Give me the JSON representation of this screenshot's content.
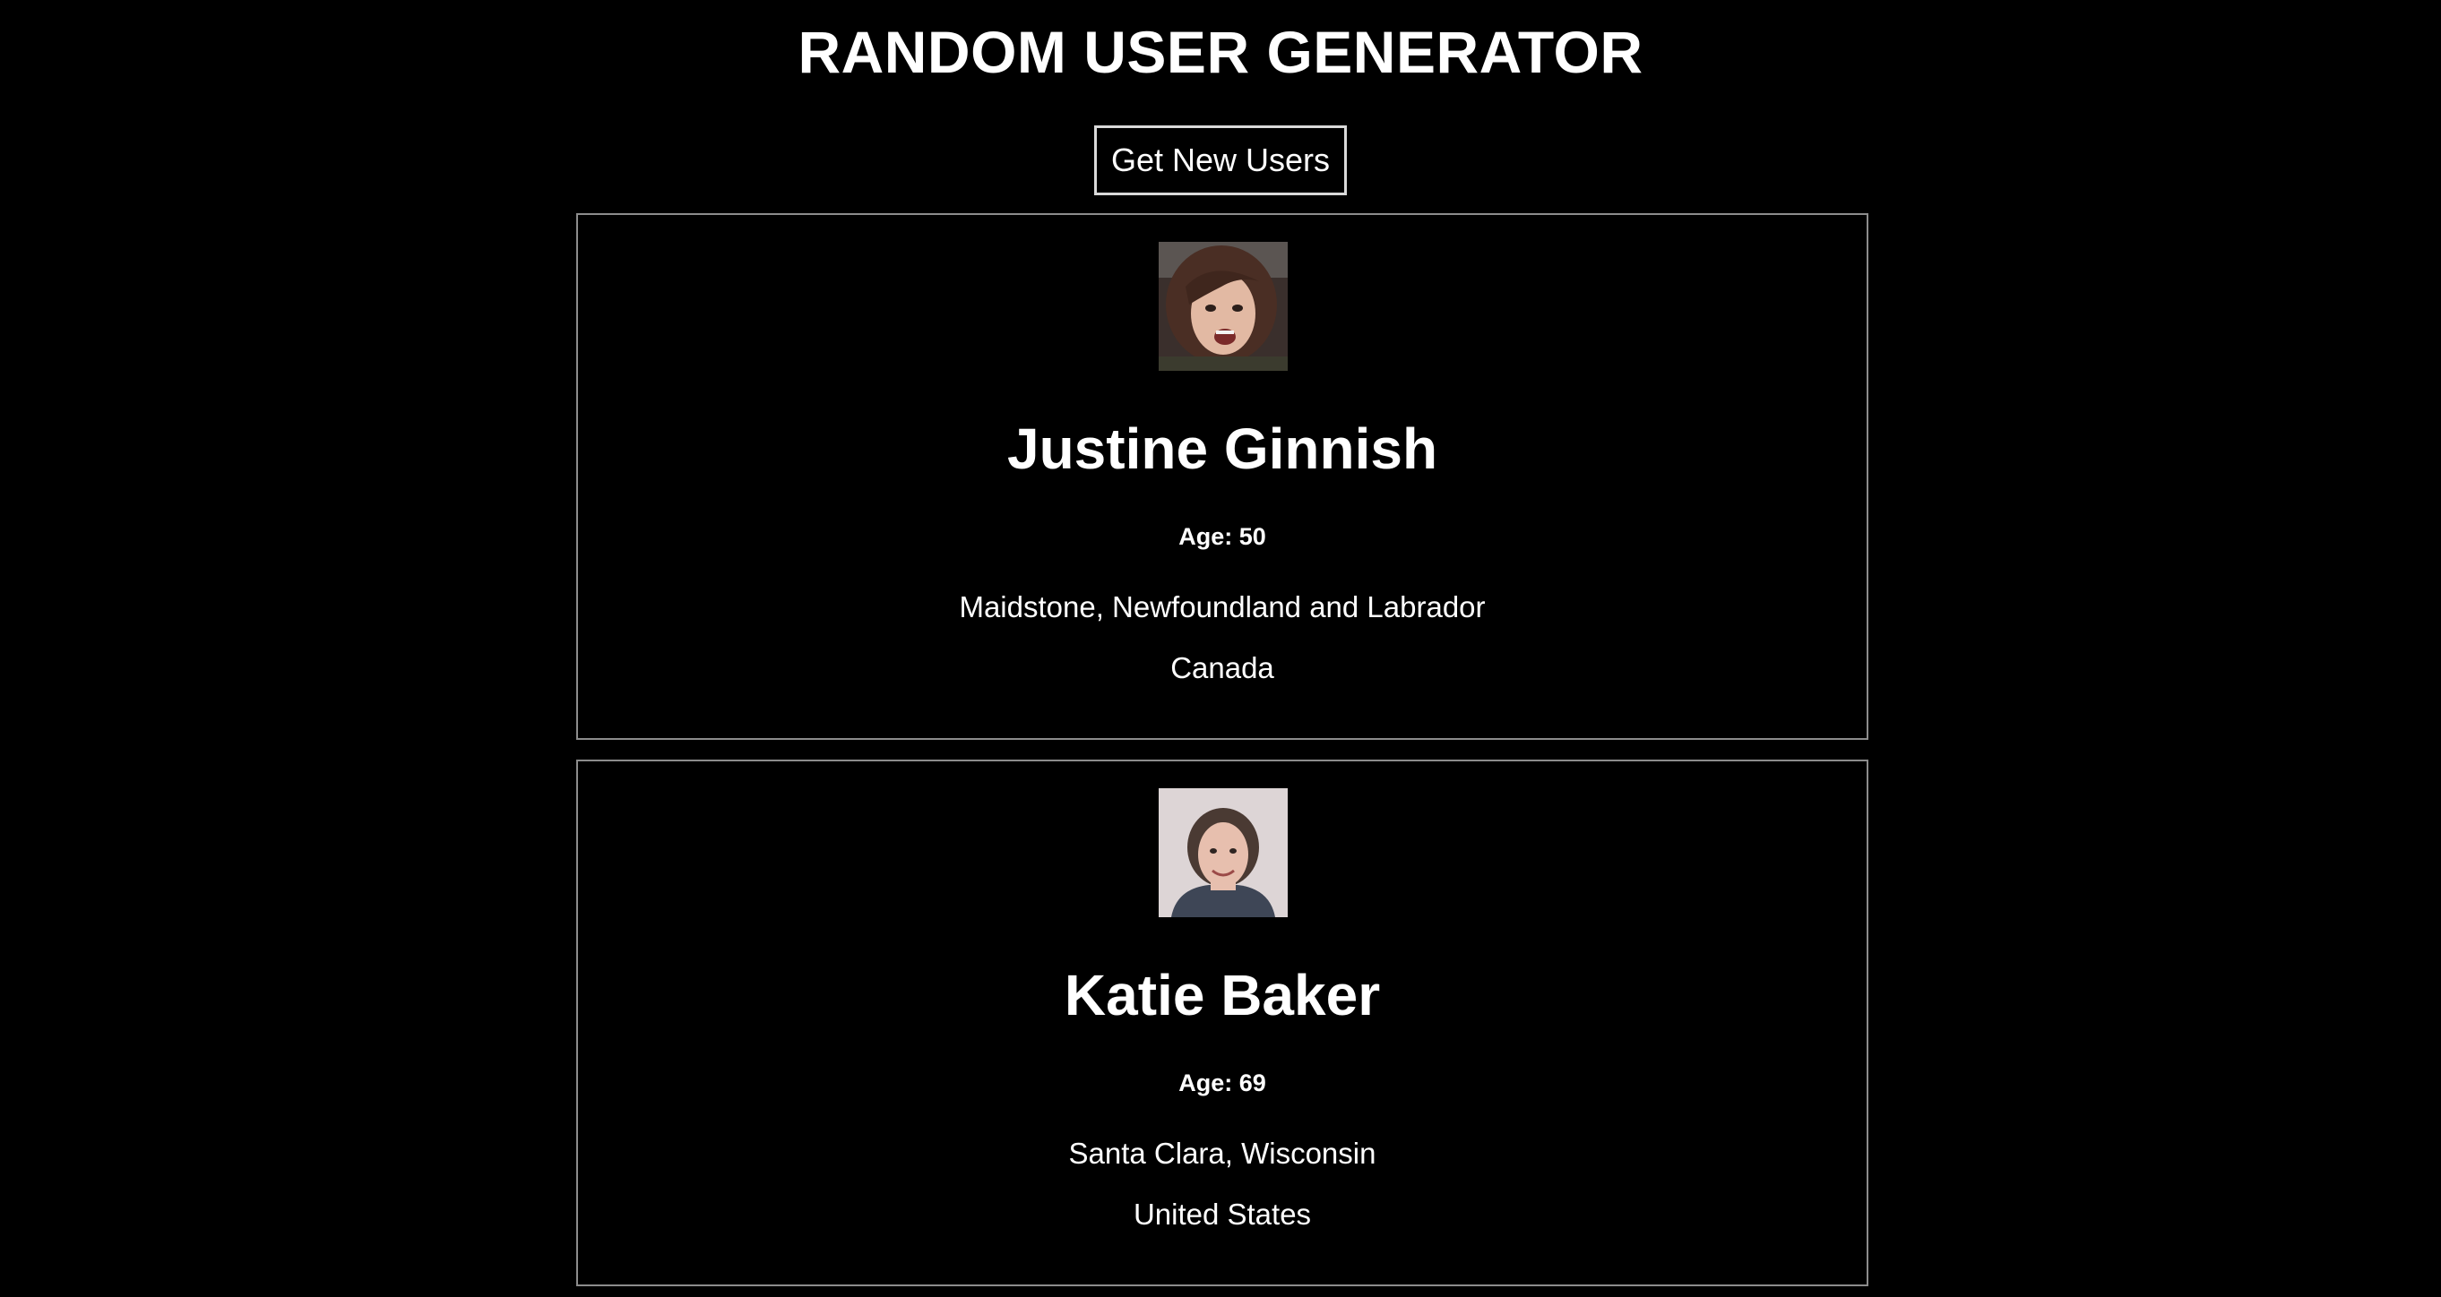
{
  "header": {
    "title": "RANDOM USER GENERATOR",
    "button_label": "Get New Users"
  },
  "users": [
    {
      "name": "Justine Ginnish",
      "age": "Age: 50",
      "location": "Maidstone, Newfoundland and Labrador",
      "country": "Canada",
      "avatar_icon": "avatar-photo-woman-smiling"
    },
    {
      "name": "Katie Baker",
      "age": "Age: 69",
      "location": "Santa Clara, Wisconsin",
      "country": "United States",
      "avatar_icon": "avatar-photo-woman-portrait"
    }
  ],
  "colors": {
    "background": "#000000",
    "text": "#ffffff",
    "card_border": "#8c8c8c",
    "button_border": "#d9d9d9"
  }
}
